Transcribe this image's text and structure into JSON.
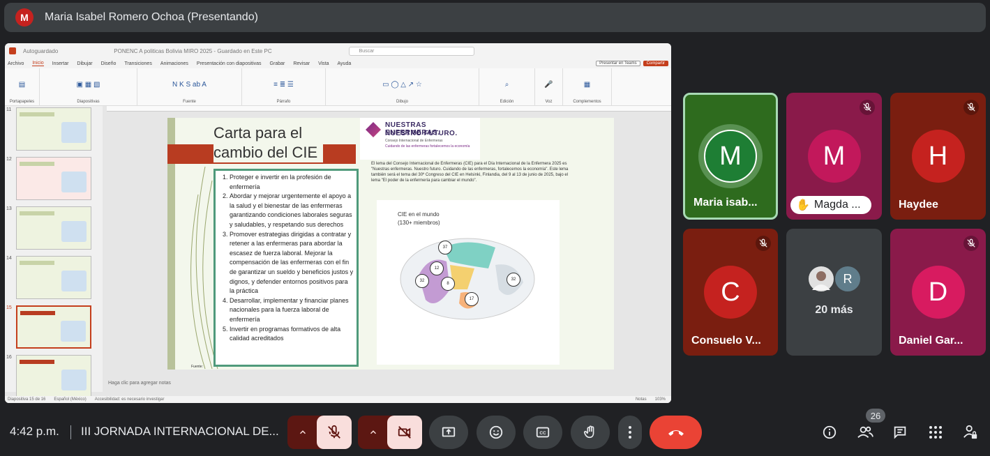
{
  "top_bar": {
    "avatar_letter": "M",
    "presenter": "Maria Isabel Romero Ochoa (Presentando)"
  },
  "ppt": {
    "window_title": "PONENC A politicas Bolivia MIRO 2025 - Guardado en Este PC",
    "autosave": "Autoguardado",
    "search": "Buscar",
    "menu": [
      "Archivo",
      "Inicio",
      "Insertar",
      "Dibujar",
      "Diseño",
      "Transiciones",
      "Animaciones",
      "Presentación con diapositivas",
      "Grabar",
      "Revisar",
      "Vista",
      "Ayuda"
    ],
    "present_btn": "Presentar en Teams",
    "share_btn": "Compartir",
    "ribbon": [
      "Portapapeles",
      "Diapositivas",
      "Fuente",
      "Párrafo",
      "Dibujo",
      "Edición",
      "Voz",
      "Complementos"
    ],
    "thumb_numbers": [
      "11",
      "12",
      "13",
      "14",
      "15",
      "16"
    ],
    "notes": "Haga clic para agregar notas",
    "status": [
      "Diapositiva 15 de 16",
      "Español (México)",
      "Accesibilidad: es necesario investigar",
      "Notas",
      "103%"
    ]
  },
  "slide": {
    "title_line1": "Carta para el",
    "title_line2": "cambio del CIE",
    "logo_line1": "NUESTRAS ENFERMERAS.",
    "logo_line2": "NUESTRO FUTURO.",
    "logo_line3": "Consejo Internacional de Enfermeras",
    "logo_line4": "Cuidando de las enfermeras fortalecemos la economía",
    "list": [
      "Proteger e invertir en la profesión de enfermería",
      "Abordar y mejorar urgentemente el apoyo a la salud y el bienestar de las enfermeras garantizando condiciones laborales seguras y saludables, y respetando sus derechos",
      "Promover estrategias dirigidas a contratar y retener a las enfermeras para abordar la escasez de fuerza laboral. Mejorar la compensación de las enfermeras con el fin de garantizar un sueldo y beneficios justos y dignos, y defender entornos positivos para la práctica",
      "Desarrollar, implementar y financiar planes nacionales para la fuerza laboral de enfermería",
      "Invertir en programas formativos de alta calidad acreditados"
    ],
    "paragraph": "El lema del Consejo Internacional de Enfermeras (CIE) para el Día Internacional de la Enfermera 2025 es \"Nuestras enfermeras. Nuestro futuro. Cuidando de las enfermeras, fortalecemos la economía\". Este lema también será el tema del 30º Congreso del CIE en Helsinki, Finlandia, del 9 al 13 de junio de 2025, bajo el lema \"El poder de la enfermería para cambiar el mundo\".",
    "map_title1": "CIE en el mundo",
    "map_title2": "(130+ miembros)",
    "map_numbers": [
      "37",
      "12",
      "32",
      "8",
      "32",
      "17"
    ],
    "source": "Fuente:"
  },
  "participants": [
    {
      "name": "Maria isab...",
      "letter": "M",
      "color": "#1e7e34",
      "tile_bg": "#2e5d1e",
      "active": true
    },
    {
      "name": "Magda ...",
      "letter": "M",
      "color": "#c2185b",
      "tile_bg": "#8a1a4a",
      "hand": true
    },
    {
      "name": "Haydee",
      "letter": "H",
      "color": "#c5221f",
      "tile_bg": "#7a1e10"
    },
    {
      "name": "Consuelo V...",
      "letter": "C",
      "color": "#c5221f",
      "tile_bg": "#7a1e10"
    },
    {
      "name": "20 más",
      "letter": "R",
      "color": "#607d8b",
      "tile_bg": "#3c4043"
    },
    {
      "name": "Daniel Gar...",
      "letter": "D",
      "color": "#d81b60",
      "tile_bg": "#8a1a4a"
    }
  ],
  "bottom": {
    "time": "4:42 p.m.",
    "meeting": "III JORNADA INTERNACIONAL DE...",
    "people_count": "26"
  }
}
